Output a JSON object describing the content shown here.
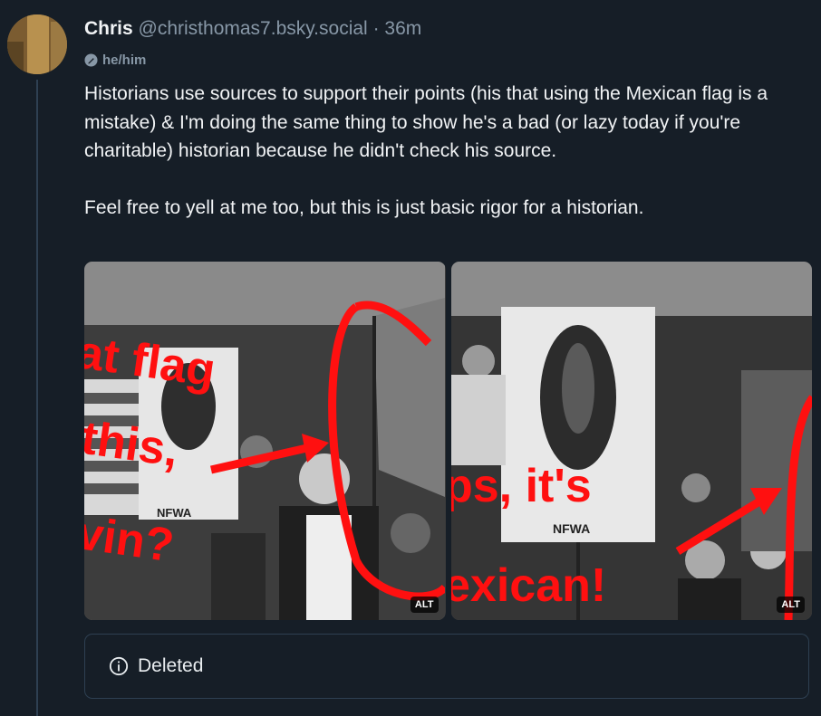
{
  "post": {
    "author_name": "Chris",
    "author_handle": "@christhomas7.bsky.social",
    "separator": "·",
    "timestamp": "36m",
    "pronouns": "he/him",
    "paragraph_1": "Historians use sources to support their points (his that using the Mexican flag is a mistake) & I'm doing the same thing to show he's a bad (or lazy today if you're charitable) historian because he didn't check his source.",
    "paragraph_2": "Feel free to yell at me too, but this is just basic rigor for a historian.",
    "images": [
      {
        "alt_label": "ALT",
        "overlay_lines": [
          "at flag",
          "this,",
          "vin?"
        ],
        "banner_text": "NFWA"
      },
      {
        "alt_label": "ALT",
        "overlay_lines": [
          "ps, it's",
          "exican!"
        ],
        "banner_text": "NFWA"
      }
    ],
    "quote": {
      "label": "Deleted"
    }
  },
  "colors": {
    "background": "#161e27",
    "text_primary": "#f1f3f5",
    "text_secondary": "#8797a6",
    "border": "#2e4052",
    "annotation_red": "#ff1010"
  }
}
